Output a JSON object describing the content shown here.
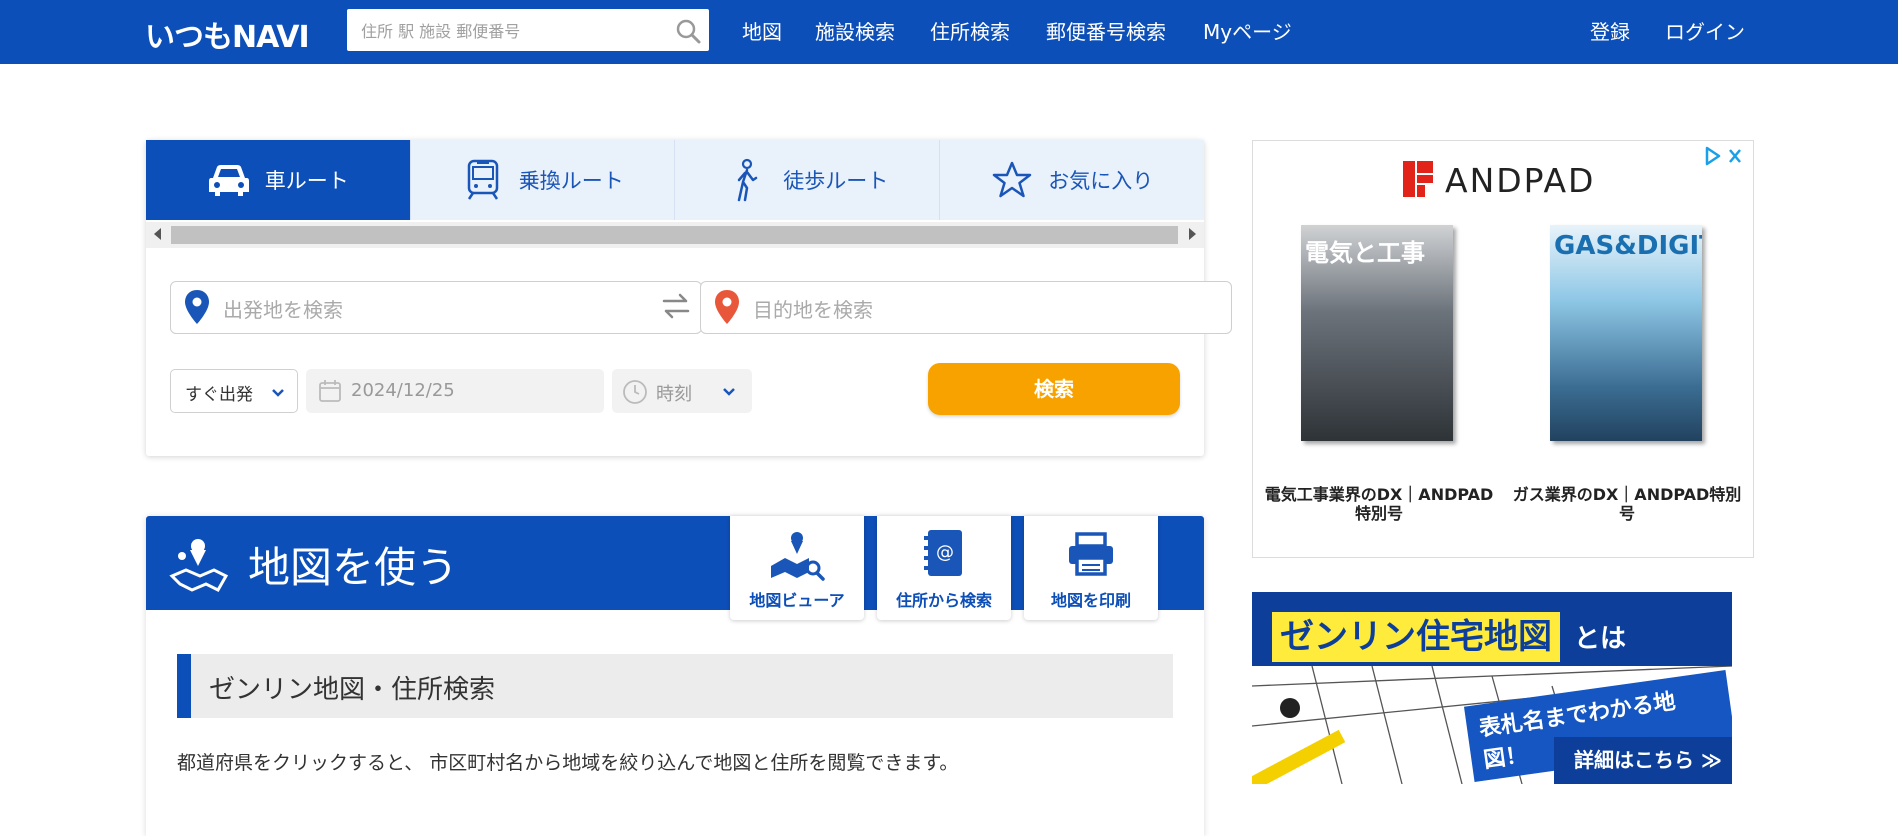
{
  "header": {
    "logo": "いつもNAVI",
    "search_placeholder": "住所 駅 施設 郵便番号",
    "nav": [
      "地図",
      "施設検索",
      "住所検索",
      "郵便番号検索",
      "Myページ"
    ],
    "register": "登録",
    "login": "ログイン"
  },
  "route": {
    "tabs": [
      "車ルート",
      "乗換ルート",
      "徒歩ルート",
      "お気に入り"
    ],
    "origin_placeholder": "出発地を検索",
    "destination_placeholder": "目的地を検索",
    "depart_mode": "すぐ出発",
    "date": "2024/12/25",
    "time_placeholder": "時刻",
    "search_button": "検索"
  },
  "map_section": {
    "title": "地図を使う",
    "buttons": [
      "地図ビューア",
      "住所から検索",
      "地図を印刷"
    ],
    "subheading": "ゼンリン地図・住所検索",
    "description": "都道府県をクリックすると、 市区町村名から地域を絞り込んで地図と住所を閲覧できます。"
  },
  "ad": {
    "brand": "ANDPAD",
    "items": [
      {
        "cover_title": "電気と工事",
        "caption": "電気工事業界のDX｜ANDPAD特別号"
      },
      {
        "cover_title": "GAS&DIGITAL",
        "caption": "ガス業界のDX｜ANDPAD特別号"
      }
    ]
  },
  "banner": {
    "title": "ゼンリン住宅地図",
    "suffix": "とは",
    "subtitle": "表札名までわかる地図！",
    "cta": "詳細はこちら ≫"
  },
  "colors": {
    "brand_blue": "#0d4fb8",
    "search_orange": "#f8a200"
  }
}
